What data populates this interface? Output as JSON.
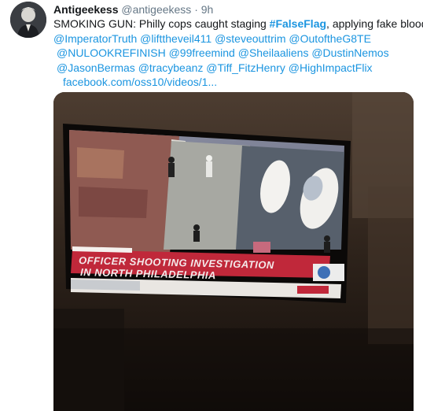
{
  "tweet": {
    "display_name": "Antigeekess",
    "handle": "@antigeekess",
    "separator": "·",
    "age": "9h",
    "text_prefix": "SMOKING GUN: Philly cops caught staging ",
    "hashtag": "#FalseFlag",
    "text_suffix": ", applying fake blood.",
    "mentions_line1": [
      "@ImperatorTruth",
      "@lifttheveil411",
      "@steveouttrim",
      "@OutoftheG8TE"
    ],
    "mentions_line2": [
      "@NULOOKREFINISH",
      "@99freemind",
      "@Sheilaaliens",
      "@DustinNemos"
    ],
    "mentions_line3": [
      "@JasonBermas",
      "@tracybeanz",
      "@Tiff_FitzHenry",
      "@HighImpactFlix"
    ],
    "link": "facebook.com/oss10/videos/1..."
  },
  "media": {
    "chyron_line1": "OFFICER SHOOTING INVESTIGATION",
    "chyron_line2": "IN NORTH PHILADELPHIA"
  },
  "colors": {
    "link": "#1b95e0",
    "text": "#14171a",
    "muted": "#657786",
    "chyron_red": "#c0283a"
  }
}
